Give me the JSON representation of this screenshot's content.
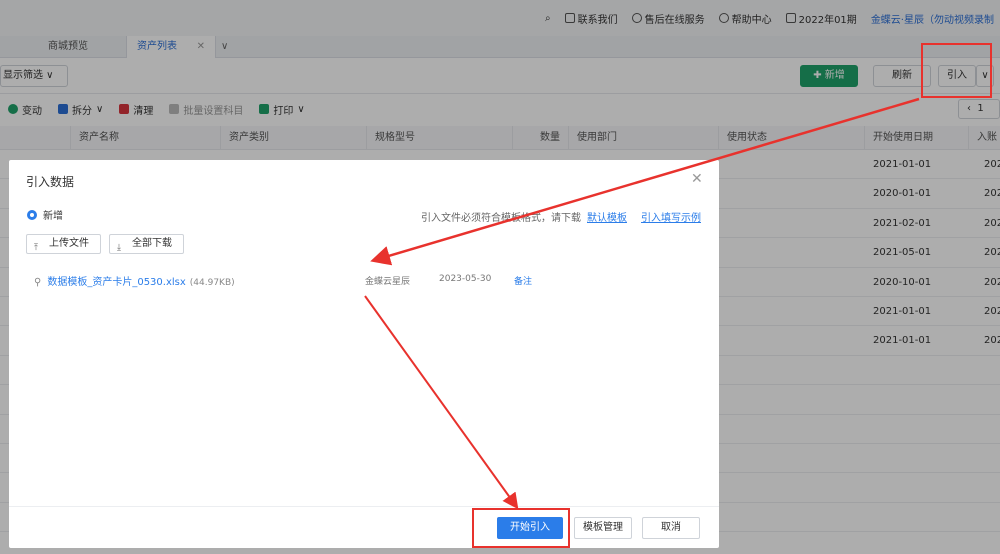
{
  "topbar": {
    "contact": "联系我们",
    "service": "售后在线服务",
    "help": "帮助中心",
    "period": "2022年01期",
    "brand": "金蝶云·星辰（勿动视频录制"
  },
  "tabs": {
    "mall": "商城预览",
    "assets": "资产列表"
  },
  "filter": {
    "label": "显示筛选"
  },
  "actions": {
    "new": "新增",
    "refresh": "刷新",
    "import": "引入"
  },
  "toolbar": {
    "change": "变动",
    "split": "拆分",
    "clear": "清理",
    "batch": "批量设置科目",
    "print": "打印"
  },
  "pager": {
    "value": "1"
  },
  "columns": [
    "资产名称",
    "资产类别",
    "规格型号",
    "数量",
    "使用部门",
    "使用状态",
    "开始使用日期",
    "入账"
  ],
  "rows": [
    {
      "date": "2021-01-01",
      "tail": "202"
    },
    {
      "date": "2020-01-01",
      "tail": "202"
    },
    {
      "date": "2021-02-01",
      "tail": "202"
    },
    {
      "date": "2021-05-01",
      "tail": "202"
    },
    {
      "date": "2020-10-01",
      "tail": "202"
    },
    {
      "date": "2021-01-01",
      "tail": "202"
    },
    {
      "date": "2021-01-01",
      "tail": "202"
    }
  ],
  "modal": {
    "title": "引入数据",
    "option": "新增",
    "hint": "引入文件必须符合模板格式，请下载",
    "link_default": "默认模板",
    "link_example": "引入填写示例",
    "upload": "上传文件",
    "download_all": "全部下载",
    "file": {
      "name": "数据模板_资产卡片_0530.xlsx",
      "size": "(44.97KB)",
      "org": "金蝶云星辰",
      "date": "2023-05-30",
      "note": "备注"
    },
    "start": "开始引入",
    "template_mgmt": "模板管理",
    "cancel": "取消"
  },
  "colors": {
    "primary": "#2b7de9",
    "green": "#1fa36a",
    "highlight": "#e8322d"
  }
}
